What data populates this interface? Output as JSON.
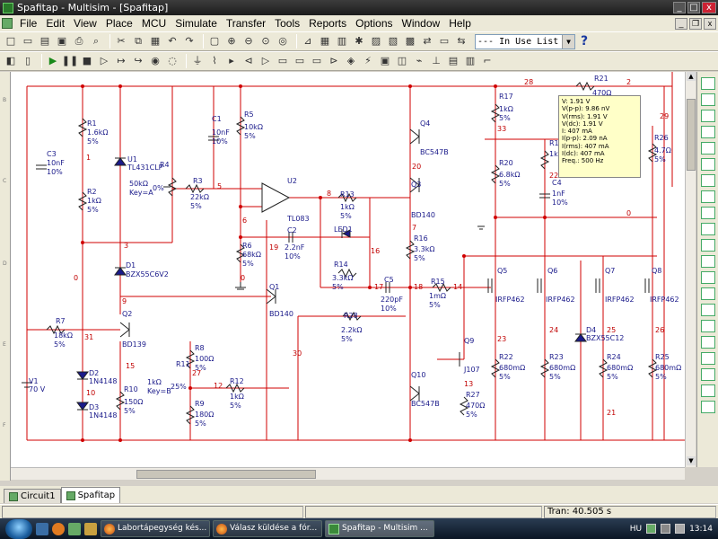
{
  "window": {
    "title": "Spafitap - Multisim - [Spafitap]",
    "minimize": "_",
    "maximize": "□",
    "close": "x"
  },
  "menu": {
    "items": [
      "File",
      "Edit",
      "View",
      "Place",
      "MCU",
      "Simulate",
      "Transfer",
      "Tools",
      "Reports",
      "Options",
      "Window",
      "Help"
    ]
  },
  "toolbar": {
    "in_use_list": "--- In Use List ---",
    "help": "?"
  },
  "probe": {
    "lines": [
      "V: 1.91 V",
      "V(p-p): 9.86 nV",
      "V(rms): 1.91 V",
      "V(dc): 1.91 V",
      "I: 407 mA",
      "I(p-p): 2.09 nA",
      "I(rms): 407 mA",
      "I(dc): 407 mA",
      "Freq.: 500 Hz"
    ]
  },
  "schematic": {
    "labels": {
      "R1": "R1",
      "R1v": "1.6kΩ",
      "R1t": "5%",
      "R2": "R2",
      "R2v": "1kΩ",
      "R2t": "5%",
      "C3": "C3",
      "C3v": "10nF",
      "C3t": "10%",
      "U1": "U1",
      "U1v": "TL431CLP",
      "R4": "R4",
      "R4v": "50kΩ",
      "R4k": "Key=A",
      "R4p": "0%",
      "R3": "R3",
      "R3v": "22kΩ",
      "R3t": "5%",
      "C1": "C1",
      "C1v": "10nF",
      "C1t": "10%",
      "R5": "R5",
      "R5v": "10kΩ",
      "R5t": "5%",
      "U2": "U2",
      "U2v": "TL083",
      "R13": "R13",
      "R13v": "1kΩ",
      "R13t": "5%",
      "C2": "C2",
      "C2v": "2.2nF",
      "C2t": "10%",
      "LED1": "LED1",
      "R14": "R14",
      "R14v": "3.3kΩ",
      "R14t": "5%",
      "R6": "R6",
      "R6v": "68kΩ",
      "R6t": "5%",
      "D1": "D1",
      "D1v": "BZX55C6V2",
      "Q1": "Q1",
      "Q1v": "BD140",
      "Q2": "Q2",
      "Q2v": "BD139",
      "R7": "R7",
      "R7v": "18kΩ",
      "R7t": "5%",
      "D2": "D2",
      "D2v": "1N4148",
      "D3": "D3",
      "D3v": "1N4148",
      "V1": "V1",
      "V1v": "70 V",
      "R10": "R10",
      "R10v": "150Ω",
      "R10t": "5%",
      "R8": "R8",
      "R8v": "100Ω",
      "R8t": "5%",
      "R11": "R11",
      "R11v": "1kΩ",
      "R11k": "Key=B",
      "R11p": "25%",
      "R9": "R9",
      "R9v": "180Ω",
      "R9t": "5%",
      "R12": "R12",
      "R12v": "1kΩ",
      "R12t": "5%",
      "R28": "R28",
      "R28v": "2.2kΩ",
      "R28t": "5%",
      "Q4": "Q4",
      "Q4v": "BC547B",
      "Q3": "Q3",
      "Q3v": "BD140",
      "R16": "R16",
      "R16v": "3.3kΩ",
      "R16t": "5%",
      "C5": "C5",
      "C5v": "220pF",
      "C5t": "10%",
      "R15": "R15",
      "R15v": "1mΩ",
      "R15t": "5%",
      "Q10": "Q10",
      "Q10v": "BC547B",
      "Q9": "Q9",
      "Q9v": "J107",
      "R27": "R27",
      "R27v": "470Ω",
      "R27t": "5%",
      "R17": "R17",
      "R17v": "1kΩ",
      "R17t": "5%",
      "R20": "R20",
      "R20v": "6.8kΩ",
      "R20t": "5%",
      "R19": "R19",
      "R19v": "1k",
      "C4": "C4",
      "C4v": "1nF",
      "C4t": "10%",
      "R21": "R21",
      "R21v": "470Ω",
      "R26": "R26",
      "R26v": "4.7Ω",
      "R26t": "5%",
      "Q5": "Q5",
      "Q5v": "IRFP462",
      "Q6": "Q6",
      "Q6v": "IRFP462",
      "Q7": "Q7",
      "Q7v": "IRFP462",
      "Q8": "Q8",
      "Q8v": "IRFP462",
      "D4": "D4",
      "D4v": "BZX55C12",
      "R22": "R22",
      "R22v": "680mΩ",
      "R22t": "5%",
      "R23": "R23",
      "R23v": "680mΩ",
      "R23t": "5%",
      "R24": "R24",
      "R24v": "680mΩ",
      "R24t": "5%",
      "R25": "R25",
      "R25v": "680mΩ",
      "R25t": "5%"
    },
    "nets": [
      "1",
      "2",
      "3",
      "5",
      "6",
      "7",
      "8",
      "9",
      "10",
      "12",
      "13",
      "14",
      "15",
      "16",
      "17",
      "18",
      "19",
      "20",
      "21",
      "22",
      "23",
      "24",
      "25",
      "26",
      "27",
      "28",
      "29",
      "30",
      "31",
      "33",
      "0",
      "0",
      "0"
    ]
  },
  "tabs": {
    "items": [
      "Circuit1",
      "Spafitap"
    ]
  },
  "status": {
    "sim": "Tran: 40.505 s"
  },
  "taskbar": {
    "items": [
      "Labortápegység kés...",
      "Válasz küldése a fór...",
      "Spafitap - Multisim ..."
    ],
    "lang": "HU",
    "clock": "13:14"
  }
}
